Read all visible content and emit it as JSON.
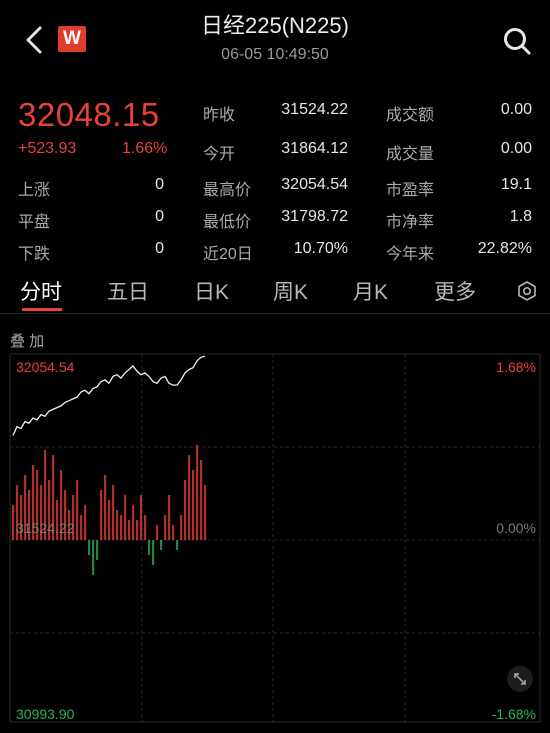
{
  "header": {
    "title": "日经225(N225)",
    "datetime": "06-05 10:49:50",
    "logo_letter": "W",
    "back_icon": "chevron-left-icon",
    "search_icon": "search-icon"
  },
  "quote": {
    "price": "32048.15",
    "change": "+523.93",
    "change_pct": "1.66%",
    "stats": [
      {
        "label": "昨收",
        "value": "31524.22"
      },
      {
        "label": "今开",
        "value": "31864.12"
      },
      {
        "label": "最高价",
        "value": "32054.54"
      },
      {
        "label": "最低价",
        "value": "31798.72"
      },
      {
        "label": "近20日",
        "value": "10.70%"
      }
    ],
    "stats2": [
      {
        "label": "成交额",
        "value": "0.00"
      },
      {
        "label": "成交量",
        "value": "0.00"
      },
      {
        "label": "市盈率",
        "value": "19.1"
      },
      {
        "label": "市净率",
        "value": "1.8"
      },
      {
        "label": "今年来",
        "value": "22.82%"
      }
    ],
    "breadth": [
      {
        "label": "上涨",
        "value": "0"
      },
      {
        "label": "平盘",
        "value": "0"
      },
      {
        "label": "下跌",
        "value": "0"
      }
    ]
  },
  "tabs": [
    "分时",
    "五日",
    "日K",
    "周K",
    "月K",
    "更多"
  ],
  "overlay_label": "叠 加",
  "chart": {
    "top_price": "32054.54",
    "top_pct": "1.68%",
    "mid_price": "31524.22",
    "mid_pct": "0.00%",
    "bottom_price": "30993.90",
    "bottom_pct": "-1.68%",
    "colors": {
      "up": "#e8413b",
      "down": "#2fb05a",
      "line": "#f2f2f2",
      "grid": "#2a2a2a"
    }
  },
  "chart_data": {
    "type": "line",
    "ylim": [
      30993.9,
      32054.54
    ],
    "reference": 31524.22,
    "price_series": [
      31820,
      31845,
      31840,
      31860,
      31855,
      31870,
      31865,
      31880,
      31875,
      31890,
      31895,
      31900,
      31905,
      31915,
      31920,
      31925,
      31930,
      31945,
      31950,
      31940,
      31955,
      31960,
      31975,
      31980,
      31970,
      31990,
      31995,
      31985,
      32000,
      32010,
      32020,
      32005,
      31995,
      32000,
      31990,
      31975,
      31970,
      31985,
      31990,
      31970,
      31965,
      31965,
      31980,
      32000,
      32010,
      32015,
      32035,
      32045,
      32048
    ],
    "volume_bars": [
      0.35,
      0.55,
      0.45,
      0.65,
      0.5,
      0.75,
      0.7,
      0.55,
      0.9,
      0.6,
      0.85,
      0.4,
      0.7,
      0.5,
      0.3,
      0.45,
      0.6,
      0.25,
      0.35,
      -0.15,
      -0.35,
      -0.2,
      0.5,
      0.65,
      0.4,
      0.55,
      0.3,
      0.25,
      0.45,
      0.2,
      0.35,
      0.2,
      0.45,
      0.25,
      -0.15,
      -0.25,
      0.15,
      -0.1,
      0.25,
      0.45,
      0.15,
      -0.1,
      0.25,
      0.6,
      0.85,
      0.7,
      0.95,
      0.8,
      0.55
    ]
  }
}
